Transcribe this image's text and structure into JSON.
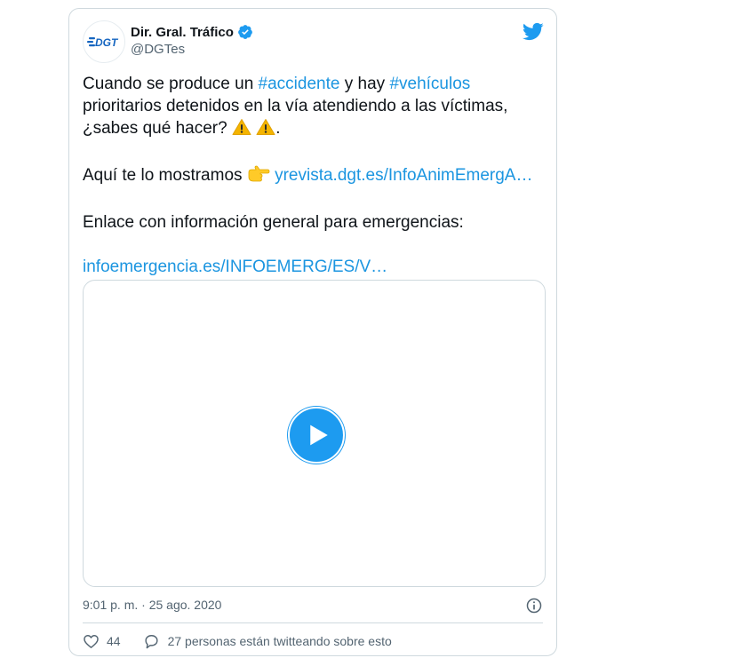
{
  "author": {
    "name": "Dir. Gral. Tráfico",
    "handle": "@DGTes",
    "logo_text": "DGT",
    "verified": true
  },
  "tweet": {
    "line1_a": "Cuando se produce un ",
    "hashtag1": "#accidente",
    "line1_b": " y hay ",
    "hashtag2": "#vehículos",
    "line2": "prioritarios detenidos en la vía atendiendo a las víctimas,",
    "line3_a": "¿sabes qué hacer? ",
    "line3_end": ".",
    "line4_a": "Aquí te lo mostramos ",
    "link1": "yrevista.dgt.es/InfoAnimEmergA…",
    "line5": "Enlace con información general para emergencias:",
    "link2": "infoemergencia.es/INFOEMERG/ES/V…"
  },
  "emoji": {
    "warning_1": "⚠️",
    "warning_2": "⚠️",
    "pointing": "👉"
  },
  "media": {
    "type": "video",
    "play_icon": "play-icon"
  },
  "meta": {
    "timestamp": "9:01 p. m. · 25 ago. 2020"
  },
  "actions": {
    "likes": "44",
    "conversation": "27 personas están twitteando sobre esto"
  },
  "colors": {
    "link": "#1b95e0",
    "brand": "#1d9bf0",
    "dgt_blue": "#1565c0",
    "secondary_text": "#536471",
    "border": "#cfd9de"
  }
}
